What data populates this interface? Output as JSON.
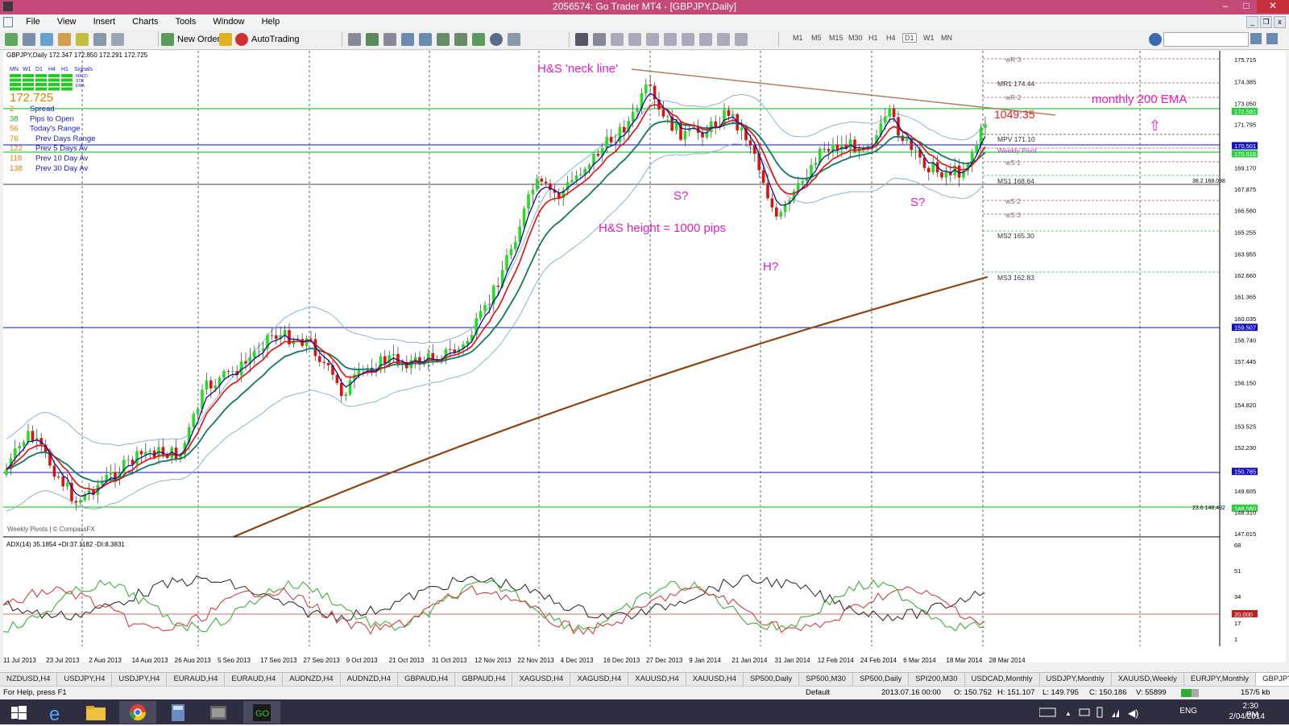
{
  "window": {
    "title": "2056574: Go Trader MT4 - [GBPJPY,Daily]",
    "minimize": "–",
    "maximize": "□",
    "close": "✕"
  },
  "menu": [
    "File",
    "View",
    "Insert",
    "Charts",
    "Tools",
    "Window",
    "Help"
  ],
  "toolbar": {
    "new_order": "New Order",
    "autotrading": "AutoTrading",
    "timeframes": [
      "M1",
      "M5",
      "M15",
      "M30",
      "H1",
      "H4",
      "D1",
      "W1",
      "MN"
    ],
    "active_timeframe": "D1"
  },
  "chart": {
    "header": "GBPJPY,Daily  172.347 172.850 172.291 172.725",
    "dashboard": {
      "timeframes": [
        "MN",
        "W1",
        "D1",
        "H4",
        "H1"
      ],
      "signals_title": "Signals",
      "signal_rows": [
        "MACD",
        "STR",
        "EMA"
      ],
      "price": "172.725",
      "stats": [
        {
          "value": "2",
          "label": "Spread"
        },
        {
          "value": "38",
          "label": "Pips to Open"
        },
        {
          "value": "56",
          "label": "Today's Range"
        },
        {
          "value": "76",
          "label": "Prev Days Range"
        },
        {
          "value": "122",
          "label": "Prev 5 Days Av"
        },
        {
          "value": "118",
          "label": "Prev 10 Day Av"
        },
        {
          "value": "138",
          "label": "Prev 30 Day Av"
        }
      ]
    },
    "annotations": {
      "neckline": "H&S 'neck line'",
      "shoulder_left": "S?",
      "head": "H?",
      "shoulder_right": "S?",
      "height": "H&S height = 1000 pips",
      "monthly_ema": "monthly 200 EMA",
      "countdown": "1049:35"
    },
    "pivots": [
      {
        "label": "wR 3",
        "value": ""
      },
      {
        "label": "MR1",
        "value": "174.44"
      },
      {
        "label": "wR 2",
        "value": ""
      },
      {
        "label": "MPV",
        "value": "171.10"
      },
      {
        "label": "Weekly Pivot",
        "value": ""
      },
      {
        "label": "wS 1",
        "value": ""
      },
      {
        "label": "MS1",
        "value": "168.64"
      },
      {
        "label": "wS 2",
        "value": ""
      },
      {
        "label": "wS 3",
        "value": ""
      },
      {
        "label": "MS2",
        "value": "165.30"
      },
      {
        "label": "MS3",
        "value": "162.83"
      }
    ],
    "fib_labels": [
      "38.2  168.098",
      "23.6  148.492"
    ],
    "watermark": "Weekly Pivots | © CompassFX",
    "price_axis": [
      "175.715",
      "174.385",
      "173.050",
      "171.795",
      "170.501",
      "170.016",
      "169.170",
      "167.875",
      "166.580",
      "165.255",
      "163.955",
      "162.660",
      "161.365",
      "160.035",
      "159.507",
      "158.740",
      "157.445",
      "156.150",
      "154.820",
      "153.525",
      "152.230",
      "150.785",
      "149.605",
      "148.560",
      "148.310",
      "147.015"
    ],
    "price_axis_highlight": {
      "172.581": "#2ecc40",
      "170.501": "#1010c0",
      "170.016": "#2ecc40",
      "159.507": "#1010c0",
      "150.785": "#1010c0",
      "148.560": "#2ecc40"
    },
    "date_axis": [
      "11 Jul 2013",
      "23 Jul 2013",
      "2 Aug 2013",
      "14 Aug 2013",
      "26 Aug 2013",
      "5 Sep 2013",
      "17 Sep 2013",
      "27 Sep 2013",
      "9 Oct 2013",
      "21 Oct 2013",
      "31 Oct 2013",
      "12 Nov 2013",
      "22 Nov 2013",
      "4 Dec 2013",
      "16 Dec 2013",
      "27 Dec 2013",
      "9 Jan 2014",
      "21 Jan 2014",
      "31 Jan 2014",
      "12 Feb 2014",
      "24 Feb 2014",
      "6 Mar 2014",
      "18 Mar 2014",
      "28 Mar 2014"
    ],
    "adx": {
      "header": "ADX(14) 35.1854 +DI:37.1182 -DI:8.3831",
      "axis": [
        "68",
        "51",
        "34",
        "20.000",
        "17",
        "1"
      ]
    }
  },
  "tabs": [
    "NZDUSD,H4",
    "USDJPY,H4",
    "USDJPY,H4",
    "EURAUD,H4",
    "EURAUD,H4",
    "AUDNZD,H4",
    "AUDNZD,H4",
    "GBPAUD,H4",
    "GBPAUD,H4",
    "XAGUSD,H4",
    "XAGUSD,H4",
    "XAUUSD,H4",
    "XAUUSD,H4",
    "SP500,Daily",
    "SP500,M30",
    "SP500,Daily",
    "SPI200,M30",
    "USDCAD,Monthly",
    "USDJPY,Monthly",
    "XAUUSD,Weekly",
    "EURJPY,Monthly",
    "GBPJPY,Daily",
    "GBPJP"
  ],
  "active_tab": "GBPJPY,Daily",
  "status": {
    "help": "For Help, press F1",
    "profile": "Default",
    "datetime": "2013.07.16 00:00",
    "open": "O: 150.752",
    "high": "H: 151.107",
    "low": "L: 149.795",
    "close": "C: 150.186",
    "volume": "V: 55899",
    "traffic": "157/5 kb"
  },
  "taskbar": {
    "lang": "ENG",
    "time": "2:30 PM",
    "date": "2/04/2014"
  },
  "colors": {
    "titlebar": "#c34a78",
    "annotation": "#e020c0",
    "ema_blue": "#101090",
    "ema_red": "#e01010",
    "ema_green": "#107860",
    "bollinger": "#8cb4d0",
    "ema200_brown": "#8b4513",
    "bull_candle": "#22dd22",
    "bear_candle": "#dd1111",
    "neckline": "#b08060"
  }
}
